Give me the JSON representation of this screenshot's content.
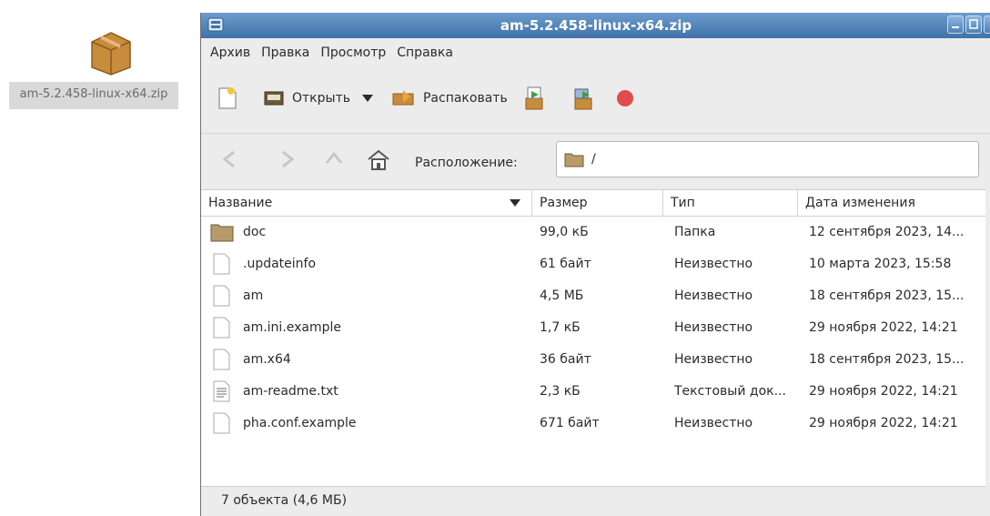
{
  "desktop": {
    "icon_name": "package-icon",
    "label": "am-5.2.458-linux-x64.zip"
  },
  "window": {
    "title": "am-5.2.458-linux-x64.zip",
    "accent": "#4a7db3"
  },
  "menu": {
    "items": [
      "Архив",
      "Правка",
      "Просмотр",
      "Справка"
    ]
  },
  "toolbar": {
    "open_label": "Открыть",
    "extract_label": "Распаковать"
  },
  "location": {
    "label": "Расположение:",
    "path": "/"
  },
  "columns": [
    "Название",
    "Размер",
    "Тип",
    "Дата изменения"
  ],
  "rows": [
    {
      "name": "doc",
      "size": "99,0 кБ",
      "type": "Папка",
      "date": "12 сентября 2023, 14...",
      "icon": "folder-icon"
    },
    {
      "name": ".updateinfo",
      "size": "61 байт",
      "type": "Неизвестно",
      "date": "10 марта 2023, 15:58",
      "icon": "file-icon"
    },
    {
      "name": "am",
      "size": "4,5 МБ",
      "type": "Неизвестно",
      "date": "18 сентября 2023, 15...",
      "icon": "file-icon"
    },
    {
      "name": "am.ini.example",
      "size": "1,7 кБ",
      "type": "Неизвестно",
      "date": "29 ноября 2022, 14:21",
      "icon": "file-icon"
    },
    {
      "name": "am.x64",
      "size": "36 байт",
      "type": "Неизвестно",
      "date": "18 сентября 2023, 15...",
      "icon": "file-icon"
    },
    {
      "name": "am-readme.txt",
      "size": "2,3 кБ",
      "type": "Текстовый док...",
      "date": "29 ноября 2022, 14:21",
      "icon": "text-file-icon"
    },
    {
      "name": "pha.conf.example",
      "size": "671 байт",
      "type": "Неизвестно",
      "date": "29 ноября 2022, 14:21",
      "icon": "file-icon"
    }
  ],
  "status": "7 объекта (4,6 МБ)"
}
